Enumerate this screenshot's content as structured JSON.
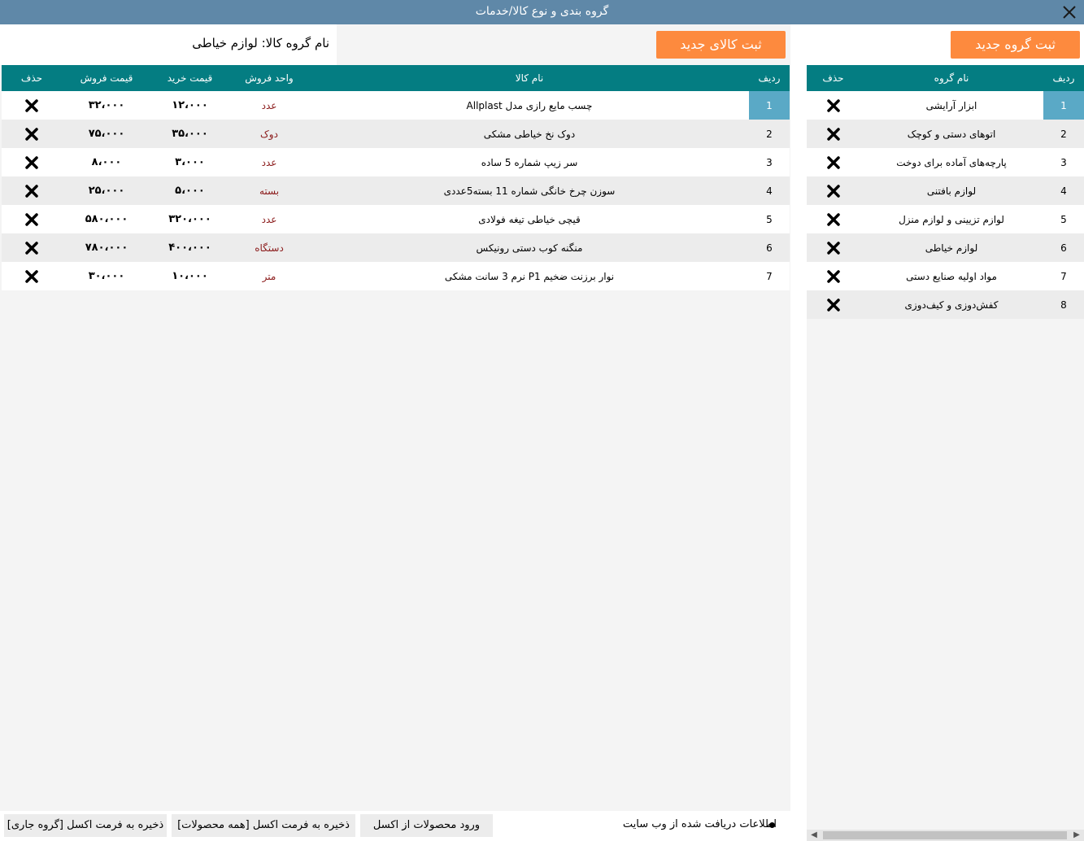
{
  "window": {
    "title": "گروه بندی و نوع کالا/خدمات"
  },
  "products": {
    "group_label": "نام گروه کالا: لوازم خیاطی",
    "new_button": "ثبت کالای جدید",
    "headers": {
      "row": "ردیف",
      "name": "نام کالا",
      "unit": "واحد فروش",
      "buy": "قیمت خرید",
      "sell": "قیمت فروش",
      "delete": "حذف"
    },
    "rows": [
      {
        "row": "1",
        "name": "چسب مایع رازی مدل Allplast",
        "unit": "عدد",
        "buy": "۱۲،۰۰۰",
        "sell": "۳۲،۰۰۰"
      },
      {
        "row": "2",
        "name": "دوک نخ خیاطی مشکی",
        "unit": "دوک",
        "buy": "۳۵،۰۰۰",
        "sell": "۷۵،۰۰۰"
      },
      {
        "row": "3",
        "name": "سر زیپ شماره 5 ساده",
        "unit": "عدد",
        "buy": "۳،۰۰۰",
        "sell": "۸،۰۰۰"
      },
      {
        "row": "4",
        "name": "سوزن چرخ خانگی شماره 11 بسته5عددی",
        "unit": "بسته",
        "buy": "۵،۰۰۰",
        "sell": "۲۵،۰۰۰"
      },
      {
        "row": "5",
        "name": "قیچی خیاطی تیغه فولادی",
        "unit": "عدد",
        "buy": "۳۲۰،۰۰۰",
        "sell": "۵۸۰،۰۰۰"
      },
      {
        "row": "6",
        "name": "منگنه کوب دستی رونیکس",
        "unit": "دستگاه",
        "buy": "۴۰۰،۰۰۰",
        "sell": "۷۸۰،۰۰۰"
      },
      {
        "row": "7",
        "name": "نوار برزنت ضخیم P1 نرم 3 سانت مشکی",
        "unit": "متر",
        "buy": "۱۰،۰۰۰",
        "sell": "۳۰،۰۰۰"
      }
    ]
  },
  "groups": {
    "new_button": "ثبت گروه جدید",
    "headers": {
      "row": "ردیف",
      "name": "نام گروه",
      "delete": "حذف"
    },
    "rows": [
      {
        "row": "1",
        "name": "ابزار آرایشی"
      },
      {
        "row": "2",
        "name": "اتوهای دستی و کوچک"
      },
      {
        "row": "3",
        "name": "پارچه‌های آماده برای دوخت"
      },
      {
        "row": "4",
        "name": "لوازم بافتنی"
      },
      {
        "row": "5",
        "name": "لوازم تزیینی و لوازم منزل"
      },
      {
        "row": "6",
        "name": "لوازم خیاطی"
      },
      {
        "row": "7",
        "name": "مواد اولیه صنایع دستی"
      },
      {
        "row": "8",
        "name": "کفش‌دوزی و کیف‌دوزی"
      }
    ]
  },
  "bottom": {
    "info": "اطلاعات دریافت شده از وب سایت",
    "import_excel": "ورود محصولات از اکسل",
    "save_all": "ذخیره به فرمت اکسل [همه محصولات]",
    "save_current": "ذخیره به فرمت اکسل [گروه جاری]"
  },
  "colors": {
    "titlebar": "#5f88a8",
    "header": "#047d82",
    "accent": "#fd8a3e",
    "selected": "#5aa9c6",
    "unit_text": "#8b1a1a"
  }
}
